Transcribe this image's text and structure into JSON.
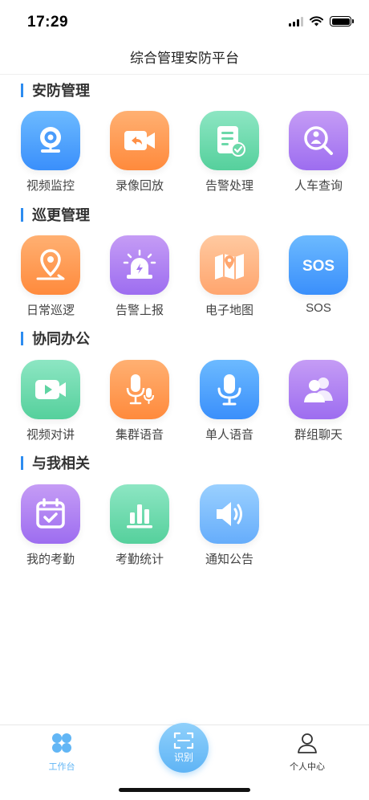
{
  "status_bar": {
    "time": "17:29"
  },
  "header": {
    "title": "综合管理安防平台"
  },
  "sections": [
    {
      "title": "安防管理",
      "items": [
        {
          "label": "视频监控",
          "icon": "webcam-icon",
          "color": "#3a8ffb"
        },
        {
          "label": "录像回放",
          "icon": "video-replay-icon",
          "color": "#ff8a3c"
        },
        {
          "label": "告警处理",
          "icon": "alarm-document-icon",
          "color": "#55d09c"
        },
        {
          "label": "人车查询",
          "icon": "person-search-icon",
          "color": "#9d6df0"
        }
      ]
    },
    {
      "title": "巡更管理",
      "items": [
        {
          "label": "日常巡逻",
          "icon": "location-pin-icon",
          "color": "#ff8a3c"
        },
        {
          "label": "告警上报",
          "icon": "siren-icon",
          "color": "#9d6df0"
        },
        {
          "label": "电子地图",
          "icon": "map-icon",
          "color": "#ffa56e"
        },
        {
          "label": "SOS",
          "icon": "sos-icon",
          "glyph": "SOS",
          "color": "#3a8ffb"
        }
      ]
    },
    {
      "title": "协同办公",
      "items": [
        {
          "label": "视频对讲",
          "icon": "video-camera-icon",
          "color": "#55d09c"
        },
        {
          "label": "集群语音",
          "icon": "group-microphone-icon",
          "color": "#ff8a3c"
        },
        {
          "label": "单人语音",
          "icon": "microphone-icon",
          "color": "#3a8ffb"
        },
        {
          "label": "群组聊天",
          "icon": "users-icon",
          "color": "#9d6df0"
        }
      ]
    },
    {
      "title": "与我相关",
      "items": [
        {
          "label": "我的考勤",
          "icon": "calendar-check-icon",
          "color": "#9d6df0"
        },
        {
          "label": "考勤统计",
          "icon": "bar-chart-icon",
          "color": "#55d09c"
        },
        {
          "label": "通知公告",
          "icon": "speaker-icon",
          "color": "#66adfb"
        }
      ]
    }
  ],
  "tabbar": {
    "work_label": "工作台",
    "scan_label": "识别",
    "me_label": "个人中心",
    "active_color": "#62b6f5"
  }
}
